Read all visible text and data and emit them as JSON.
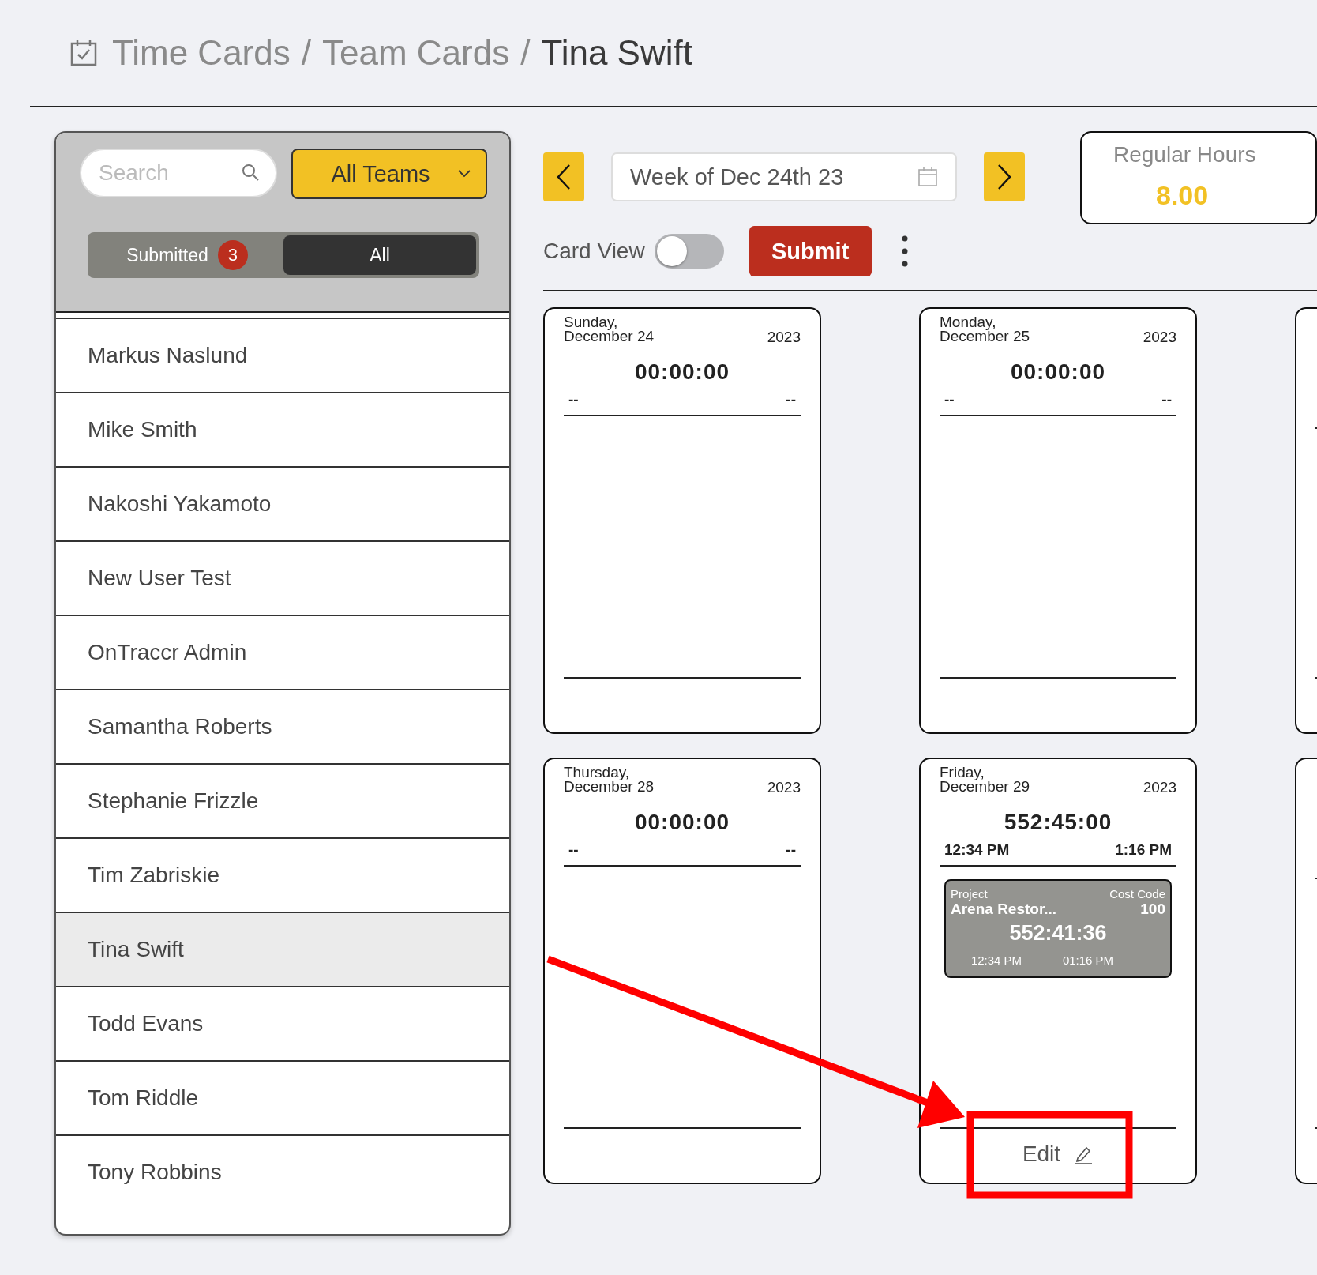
{
  "breadcrumb": [
    {
      "label": "Time Cards",
      "current": false
    },
    {
      "separator": "/",
      "label": "Team Cards",
      "current": false
    },
    {
      "separator": "/",
      "label": "Tina Swift",
      "current": true
    }
  ],
  "sidebar": {
    "search": {
      "placeholder": "Search"
    },
    "team_filter": "All Teams",
    "segments": [
      {
        "label": "Submitted",
        "badge": "3",
        "selected": false
      },
      {
        "label": "All",
        "selected": true
      }
    ],
    "people": [
      {
        "name": "Markus Naslund",
        "selected": false
      },
      {
        "name": "Mike Smith",
        "selected": false
      },
      {
        "name": "Nakoshi Yakamoto",
        "selected": false
      },
      {
        "name": "New User Test",
        "selected": false
      },
      {
        "name": "OnTraccr Admin",
        "selected": false
      },
      {
        "name": "Samantha Roberts",
        "selected": false
      },
      {
        "name": "Stephanie Frizzle",
        "selected": false
      },
      {
        "name": "Tim Zabriskie",
        "selected": false
      },
      {
        "name": "Tina Swift",
        "selected": true
      },
      {
        "name": "Todd Evans",
        "selected": false
      },
      {
        "name": "Tom Riddle",
        "selected": false
      },
      {
        "name": "Tony Robbins",
        "selected": false
      }
    ]
  },
  "toolbar": {
    "week": "Week of Dec 24th 23",
    "regular_hours": {
      "label": "Regular Hours",
      "value": "8.00"
    },
    "card_view": {
      "label": "Card View",
      "on": false
    },
    "submit": "Submit"
  },
  "days": [
    {
      "kind": "full",
      "weekday": "Sunday,",
      "date": "December 24",
      "year": "2023",
      "total": "00:00:00",
      "start": "--",
      "end": "--"
    },
    {
      "kind": "full",
      "weekday": "Monday,",
      "date": "December 25",
      "year": "2023",
      "total": "00:00:00",
      "start": "--",
      "end": "--"
    },
    {
      "kind": "clipped"
    },
    {
      "kind": "full",
      "weekday": "Thursday,",
      "date": "December 28",
      "year": "2023",
      "total": "00:00:00",
      "start": "--",
      "end": "--"
    },
    {
      "kind": "full",
      "weekday": "Friday,",
      "date": "December 29",
      "year": "2023",
      "total": "552:45:00",
      "start": "12:34 PM",
      "end": "1:16 PM",
      "entries": [
        {
          "project_label": "Project",
          "project": "Arena Restor...",
          "cost_code_label": "Cost Code",
          "cost_code": "100",
          "duration": "552:41:36",
          "start": "12:34 PM",
          "end": "01:16 PM"
        }
      ],
      "edit": "Edit"
    },
    {
      "kind": "clipped"
    }
  ],
  "annotation": {
    "arrow": true,
    "highlight_box": true
  }
}
